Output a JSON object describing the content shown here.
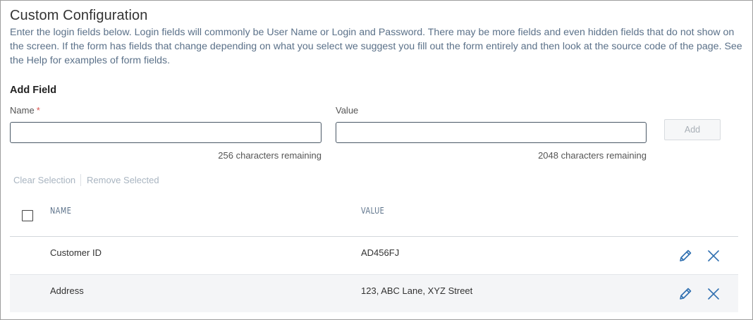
{
  "header": {
    "title": "Custom Configuration",
    "description": "Enter the login fields below. Login fields will commonly be User Name or Login and Password. There may be more fields and even hidden fields that do not show on the screen. If the form has fields that change depending on what you select we suggest you fill out the form entirely and then look at the source code of the page. See the Help for examples of form fields."
  },
  "add_field": {
    "section_label": "Add Field",
    "name_label": "Name",
    "name_required_mark": "*",
    "name_value": "",
    "name_remaining": "256 characters remaining",
    "value_label": "Value",
    "value_value": "",
    "value_remaining": "2048 characters remaining",
    "add_label": "Add"
  },
  "actions": {
    "clear_selection": "Clear Selection",
    "remove_selected": "Remove Selected"
  },
  "table": {
    "columns": [
      "NAME",
      "VALUE"
    ],
    "rows": [
      {
        "name": "Customer ID",
        "value": "AD456FJ"
      },
      {
        "name": "Address",
        "value": "123, ABC Lane, XYZ Street"
      }
    ]
  },
  "icons": {
    "edit": "pencil-icon",
    "delete": "close-icon"
  },
  "colors": {
    "icon_blue": "#2f6fb0",
    "description_text": "#5b7189",
    "required": "#d9534f"
  }
}
